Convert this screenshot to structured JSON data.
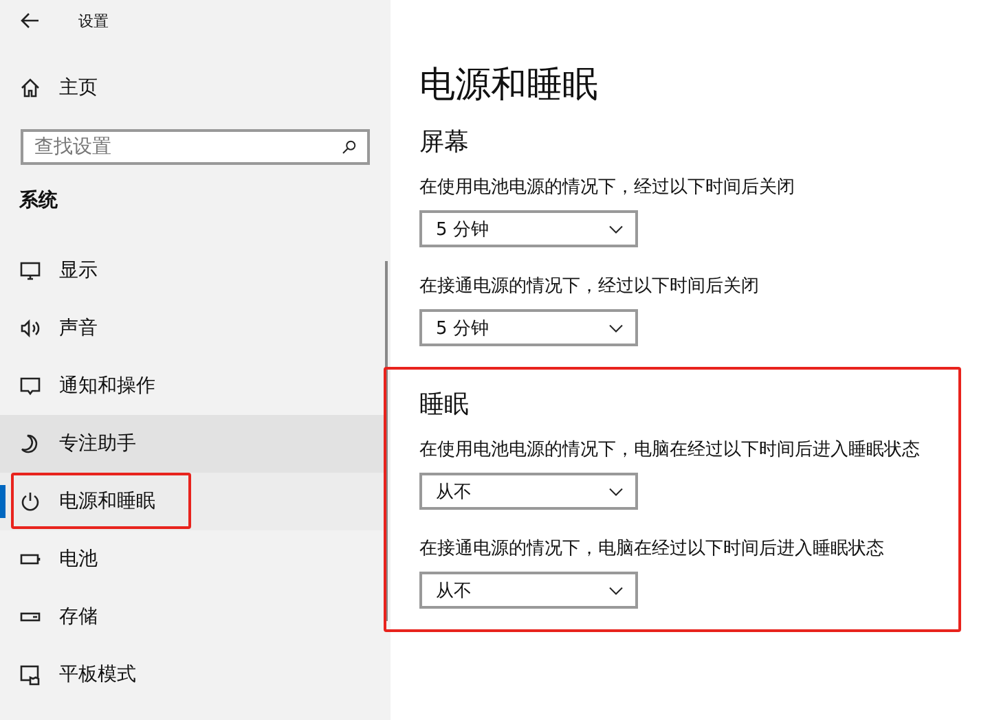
{
  "window": {
    "title": "设置"
  },
  "sidebar": {
    "home": "主页",
    "search": {
      "placeholder": "查找设置"
    },
    "section": "系统",
    "items": [
      {
        "kind": "display",
        "label": "显示",
        "selected": false,
        "hovered": false,
        "highlighted": false
      },
      {
        "kind": "sound",
        "label": "声音",
        "selected": false,
        "hovered": false,
        "highlighted": false
      },
      {
        "kind": "notifications",
        "label": "通知和操作",
        "selected": false,
        "hovered": false,
        "highlighted": false
      },
      {
        "kind": "focus",
        "label": "专注助手",
        "selected": false,
        "hovered": true,
        "highlighted": false
      },
      {
        "kind": "power",
        "label": "电源和睡眠",
        "selected": true,
        "hovered": false,
        "highlighted": true
      },
      {
        "kind": "battery",
        "label": "电池",
        "selected": false,
        "hovered": false,
        "highlighted": false
      },
      {
        "kind": "storage",
        "label": "存储",
        "selected": false,
        "hovered": false,
        "highlighted": false
      },
      {
        "kind": "tablet",
        "label": "平板模式",
        "selected": false,
        "hovered": false,
        "highlighted": false
      }
    ]
  },
  "page": {
    "title": "电源和睡眠",
    "sections": [
      {
        "heading": "屏幕",
        "highlighted": false,
        "settings": [
          {
            "label": "在使用电池电源的情况下，经过以下时间后关闭",
            "value": "5 分钟"
          },
          {
            "label": "在接通电源的情况下，经过以下时间后关闭",
            "value": "5 分钟"
          }
        ]
      },
      {
        "heading": "睡眠",
        "highlighted": true,
        "settings": [
          {
            "label": "在使用电池电源的情况下，电脑在经过以下时间后进入睡眠状态",
            "value": "从不"
          },
          {
            "label": "在接通电源的情况下，电脑在经过以下时间后进入睡眠状态",
            "value": "从不"
          }
        ]
      }
    ]
  }
}
